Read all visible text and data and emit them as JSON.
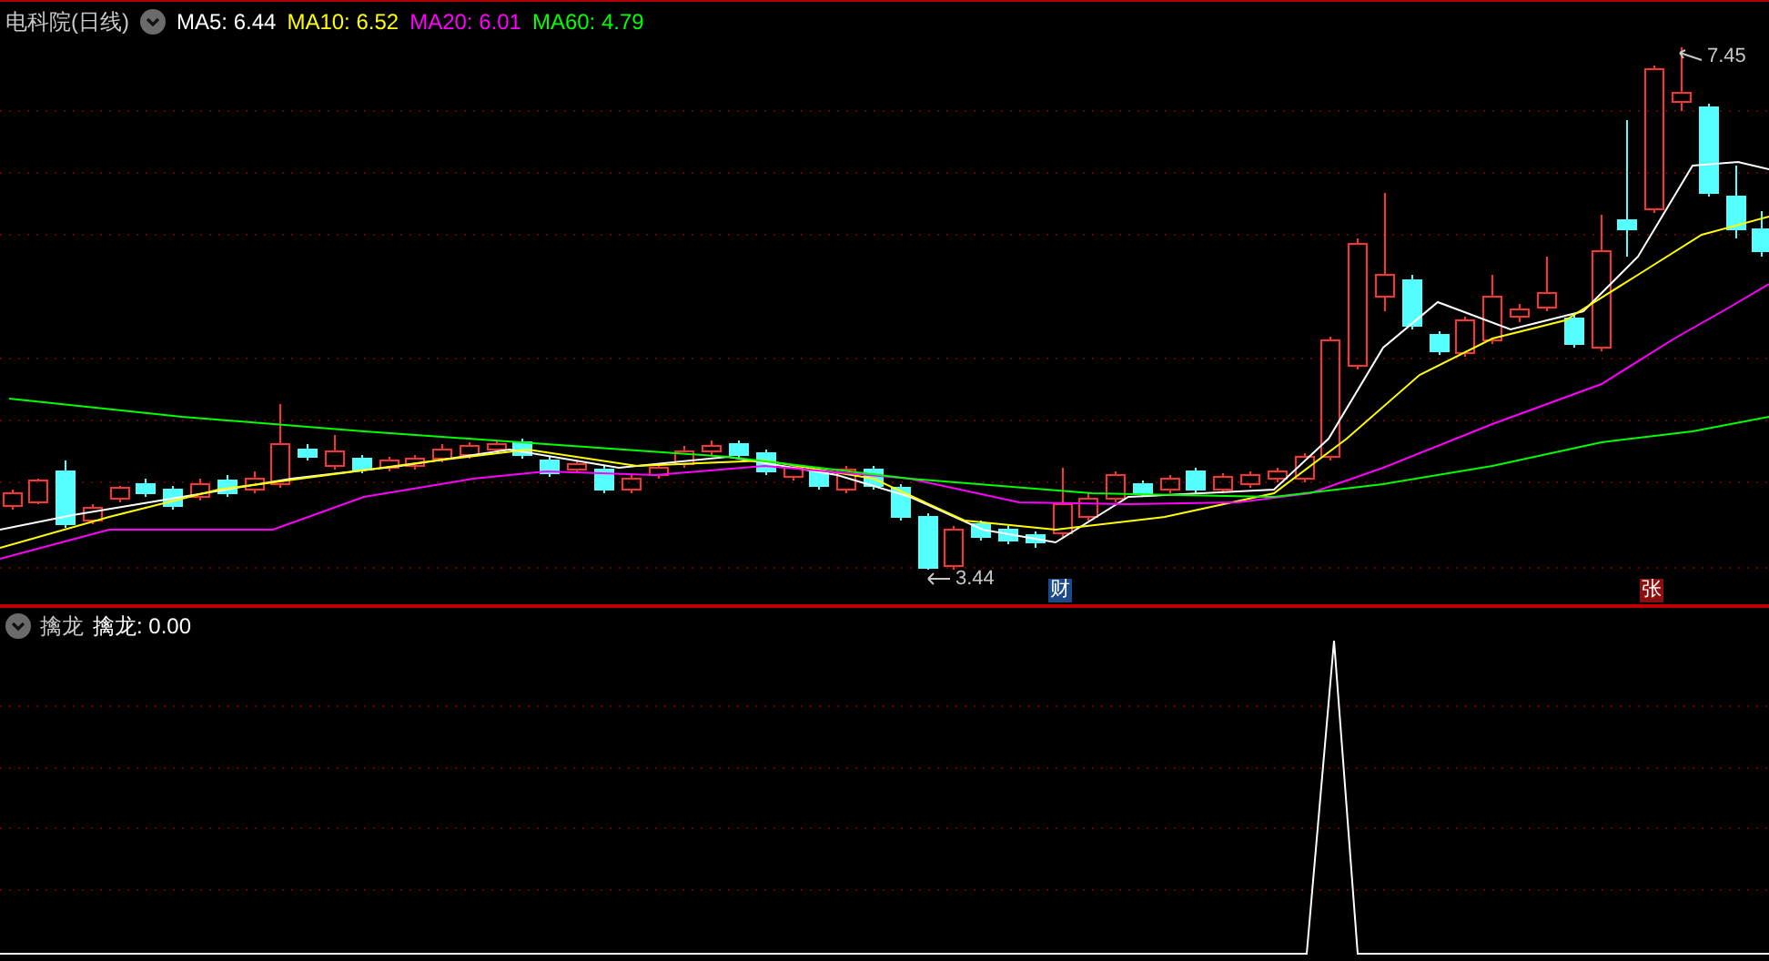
{
  "title": {
    "name": "电科院(日线)"
  },
  "ma_legend": [
    {
      "label": "MA5: 6.44",
      "color": "#ffffff"
    },
    {
      "label": "MA10: 6.52",
      "color": "#ffff00"
    },
    {
      "label": "MA20: 6.01",
      "color": "#ff00ff"
    },
    {
      "label": "MA60: 4.79",
      "color": "#00ff00"
    }
  ],
  "price_markers": [
    {
      "kind": "high",
      "text": "7.45"
    },
    {
      "kind": "low",
      "text": "3.44"
    }
  ],
  "event_badges": [
    {
      "text": "财",
      "color": "#1c4a86"
    },
    {
      "text": "张",
      "color": "#8c0f0f"
    }
  ],
  "indicator": {
    "name": "擒龙",
    "reading": "擒龙: 0.00"
  }
}
